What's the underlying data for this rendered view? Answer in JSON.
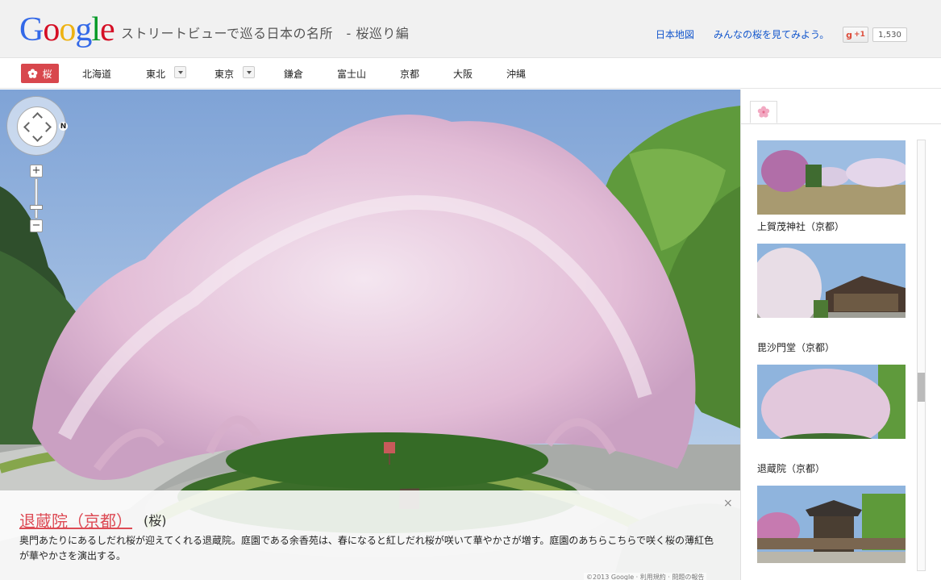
{
  "header": {
    "logo": [
      "G",
      "o",
      "o",
      "g",
      "l",
      "e"
    ],
    "logo_colors": [
      "#3369e8",
      "#d50f25",
      "#eeb211",
      "#3369e8",
      "#009925",
      "#d50f25"
    ],
    "title": "ストリートビューで巡る日本の名所　- 桜巡り編",
    "links": [
      "日本地図",
      "みんなの桜を見てみよう。"
    ],
    "gplus_label": "+1",
    "gplus_count": "1,530"
  },
  "nav": {
    "active_label": "桜",
    "items": [
      "北海道",
      "東北",
      "東京",
      "鎌倉",
      "富士山",
      "京都",
      "大阪",
      "沖縄"
    ]
  },
  "streetview": {
    "compass_label": "N",
    "zoom_in": "+",
    "zoom_out": "−",
    "info_title": "退蔵院（京都）",
    "info_tag": "(桜)",
    "info_desc": "奥門あたりにあるしだれ桜が迎えてくれる退蔵院。庭園である余香苑は、春になると紅しだれ桜が咲いて華やかさが増す。庭園のあちらこちらで咲く桜の薄紅色が華やかさを演出する。",
    "close": "×",
    "copyright": "©2013 Google · 利用規約 · 問題の報告"
  },
  "panel": {
    "items": [
      {
        "caption": "上賀茂神社（京都）"
      },
      {
        "caption": "毘沙門堂（京都）"
      },
      {
        "caption": "退蔵院（京都）"
      },
      {
        "caption": ""
      }
    ]
  },
  "colors": {
    "accent": "#d8474d",
    "link": "#1155cc",
    "sakura": "#e9c6de"
  }
}
